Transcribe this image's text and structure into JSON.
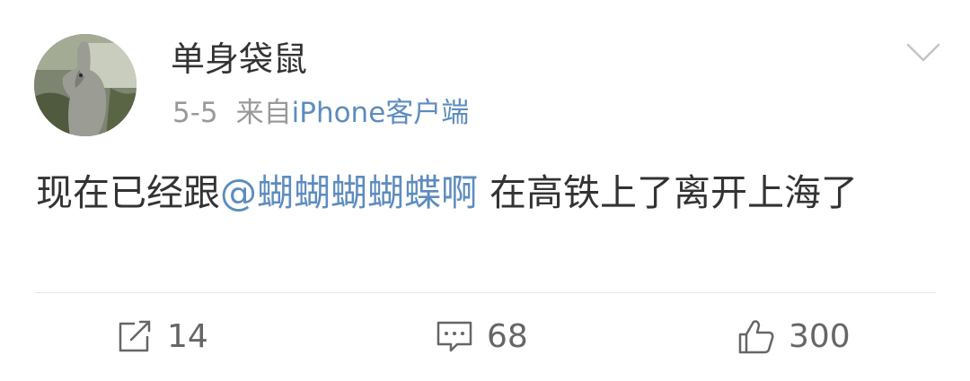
{
  "post": {
    "username": "单身袋鼠",
    "date": "5-5",
    "source_prefix": "来自",
    "source_app": "iPhone客户端",
    "text_before": "现在已经跟",
    "mention": "@蝴蝴蝴蝴蝶啊",
    "text_after": " 在高铁上了离开上海了"
  },
  "actions": {
    "repost_count": "14",
    "comment_count": "68",
    "like_count": "300"
  },
  "icons": {
    "menu": "chevron-down-icon",
    "repost": "repost-icon",
    "comment": "comment-icon",
    "like": "thumbs-up-icon"
  },
  "colors": {
    "link": "#5d8cbe",
    "meta_text": "#999999",
    "body_text": "#333333"
  }
}
